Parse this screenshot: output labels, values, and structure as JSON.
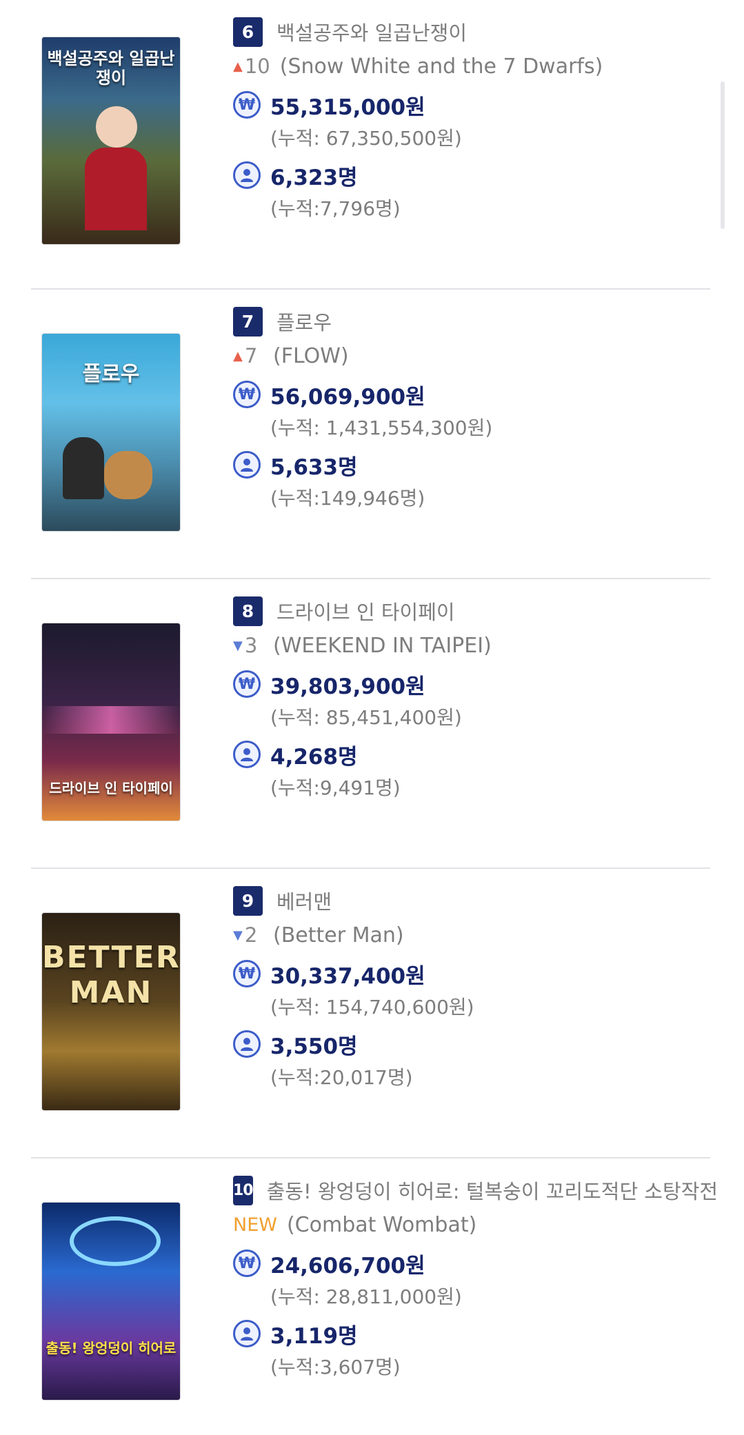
{
  "items": [
    {
      "rank": "6",
      "change_dir": "up",
      "change": "10",
      "ko_title": "백설공주와 일곱난쟁이",
      "en_title": "(Snow White and the 7 Dwarfs)",
      "sales": "55,315,000원",
      "sales_cum": "(누적: 67,350,500원)",
      "audience": "6,323명",
      "audience_cum": "(누적:7,796명)",
      "poster_text": "백설공주와 일곱난쟁이"
    },
    {
      "rank": "7",
      "change_dir": "up",
      "change": "7",
      "ko_title": "플로우",
      "en_title": "(FLOW)",
      "sales": "56,069,900원",
      "sales_cum": "(누적: 1,431,554,300원)",
      "audience": "5,633명",
      "audience_cum": "(누적:149,946명)",
      "poster_text": "플로우"
    },
    {
      "rank": "8",
      "change_dir": "down",
      "change": "3",
      "ko_title": "드라이브 인 타이페이",
      "en_title": "(WEEKEND IN TAIPEI)",
      "sales": "39,803,900원",
      "sales_cum": "(누적: 85,451,400원)",
      "audience": "4,268명",
      "audience_cum": "(누적:9,491명)",
      "poster_text": "드라이브 인 타이페이"
    },
    {
      "rank": "9",
      "change_dir": "down",
      "change": "2",
      "ko_title": "베러맨",
      "en_title": "(Better Man)",
      "sales": "30,337,400원",
      "sales_cum": "(누적: 154,740,600원)",
      "audience": "3,550명",
      "audience_cum": "(누적:20,017명)",
      "poster_text": "BETTER MAN"
    },
    {
      "rank": "10",
      "change_dir": "new",
      "change": "NEW",
      "ko_title": "출동! 왕엉덩이 히어로: 털복숭이 꼬리도적단 소탕작전",
      "en_title": "(Combat Wombat)",
      "sales": "24,606,700원",
      "sales_cum": "(누적: 28,811,000원)",
      "audience": "3,119명",
      "audience_cum": "(누적:3,607명)",
      "poster_text": "출동! 왕엉덩이 히어로"
    }
  ],
  "icons": {
    "sales": "won-icon",
    "audience": "person-icon",
    "up": "arrow-up-icon",
    "down": "arrow-down-icon"
  },
  "colors": {
    "rank_bg": "#1a2b6b",
    "up": "#e8604c",
    "down": "#5b7cd6",
    "new": "#f0a030",
    "icon": "#3c5cc9"
  }
}
